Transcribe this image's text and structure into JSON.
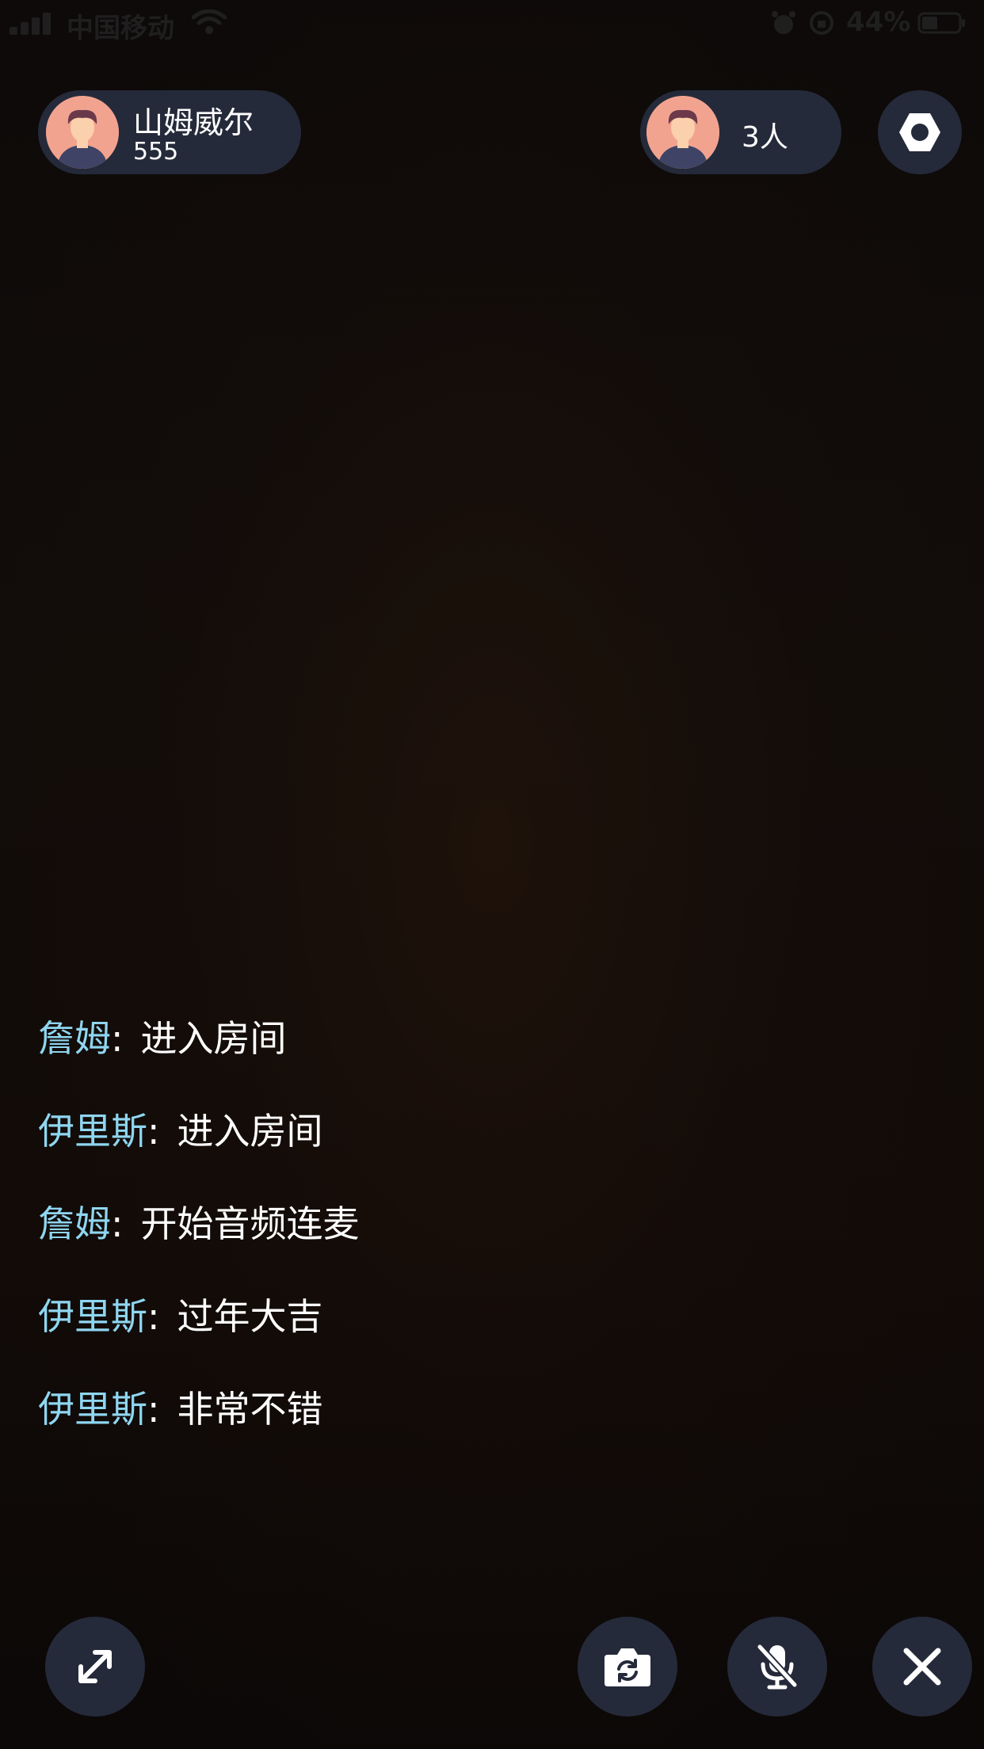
{
  "status_bar": {
    "carrier": "中国移动",
    "battery_percent": "44%",
    "battery_level": 0.44,
    "icons": [
      "signal-icon",
      "wifi-icon",
      "alarm-icon",
      "rotation-lock-icon",
      "battery-icon"
    ]
  },
  "host": {
    "name": "山姆威尔",
    "id": "555",
    "avatar_icon": "user-avatar-icon"
  },
  "audience": {
    "count_label": "3人",
    "avatar_icon": "user-avatar-icon"
  },
  "settings": {
    "icon": "hexagon-settings-icon"
  },
  "chat": {
    "separator": ":",
    "messages": [
      {
        "user": "詹姆",
        "text": "进入房间"
      },
      {
        "user": "伊里斯",
        "text": "进入房间"
      },
      {
        "user": "詹姆",
        "text": "开始音频连麦"
      },
      {
        "user": "伊里斯",
        "text": "过年大吉"
      },
      {
        "user": "伊里斯",
        "text": "非常不错"
      }
    ]
  },
  "controls": {
    "expand_icon": "expand-icon",
    "camera_icon": "switch-camera-icon",
    "mic_icon": "mic-muted-icon",
    "close_icon": "close-icon"
  },
  "colors": {
    "background": "#0b0807",
    "pill": "#252a3a",
    "username": "#8fd6f0",
    "text": "#ffffff",
    "avatar_bg": "#f2a38f"
  }
}
